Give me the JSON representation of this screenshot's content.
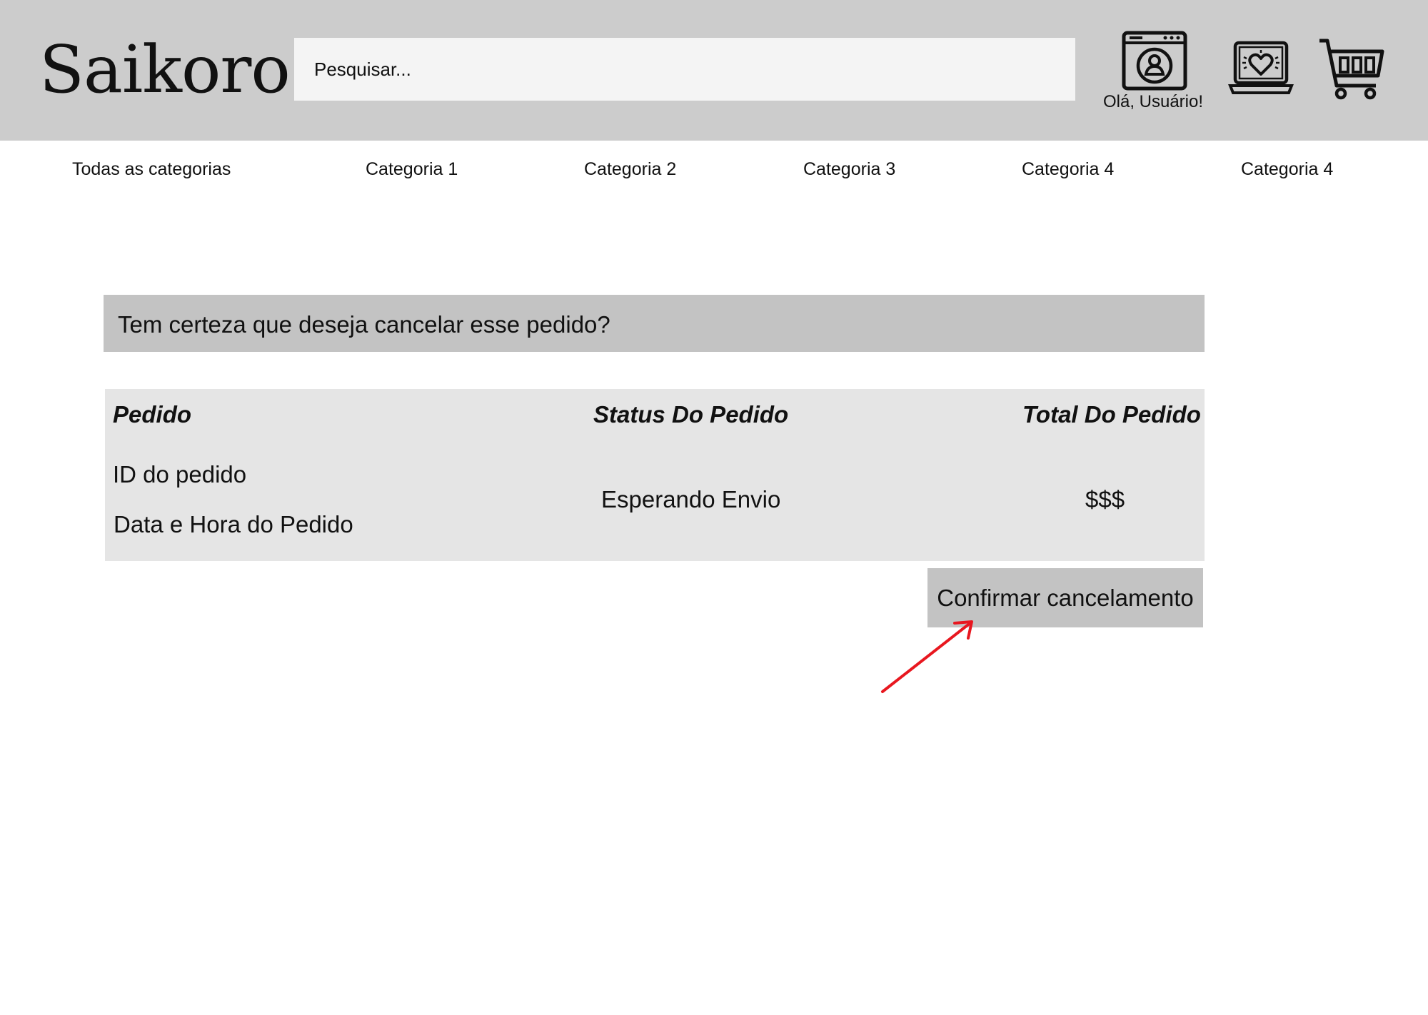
{
  "header": {
    "logo": "Saikoro",
    "search_placeholder": "Pesquisar...",
    "greeting": "Olá, Usuário!",
    "icons": [
      "account-icon",
      "wishlist-icon",
      "cart-icon"
    ]
  },
  "categories": [
    "Todas as categorias",
    "Categoria 1",
    "Categoria 2",
    "Categoria 3",
    "Categoria 4",
    "Categoria 4"
  ],
  "confirm": {
    "question": "Tem certeza que deseja cancelar esse pedido?"
  },
  "order_table": {
    "headers": [
      "Pedido",
      "Status Do Pedido",
      "Total Do Pedido"
    ],
    "row": {
      "order_id": "ID do pedido",
      "order_datetime": "Data e Hora do Pedido",
      "status": "Esperando Envio",
      "total": "$$$"
    }
  },
  "actions": {
    "confirm_cancel_label": "Confirmar cancelamento"
  },
  "colors": {
    "header_bg": "#cccccc",
    "search_bg": "#f4f4f4",
    "confirm_bar_bg": "#c3c3c3",
    "table_bg": "#e5e5e5",
    "annotation_arrow": "#e8171f"
  }
}
